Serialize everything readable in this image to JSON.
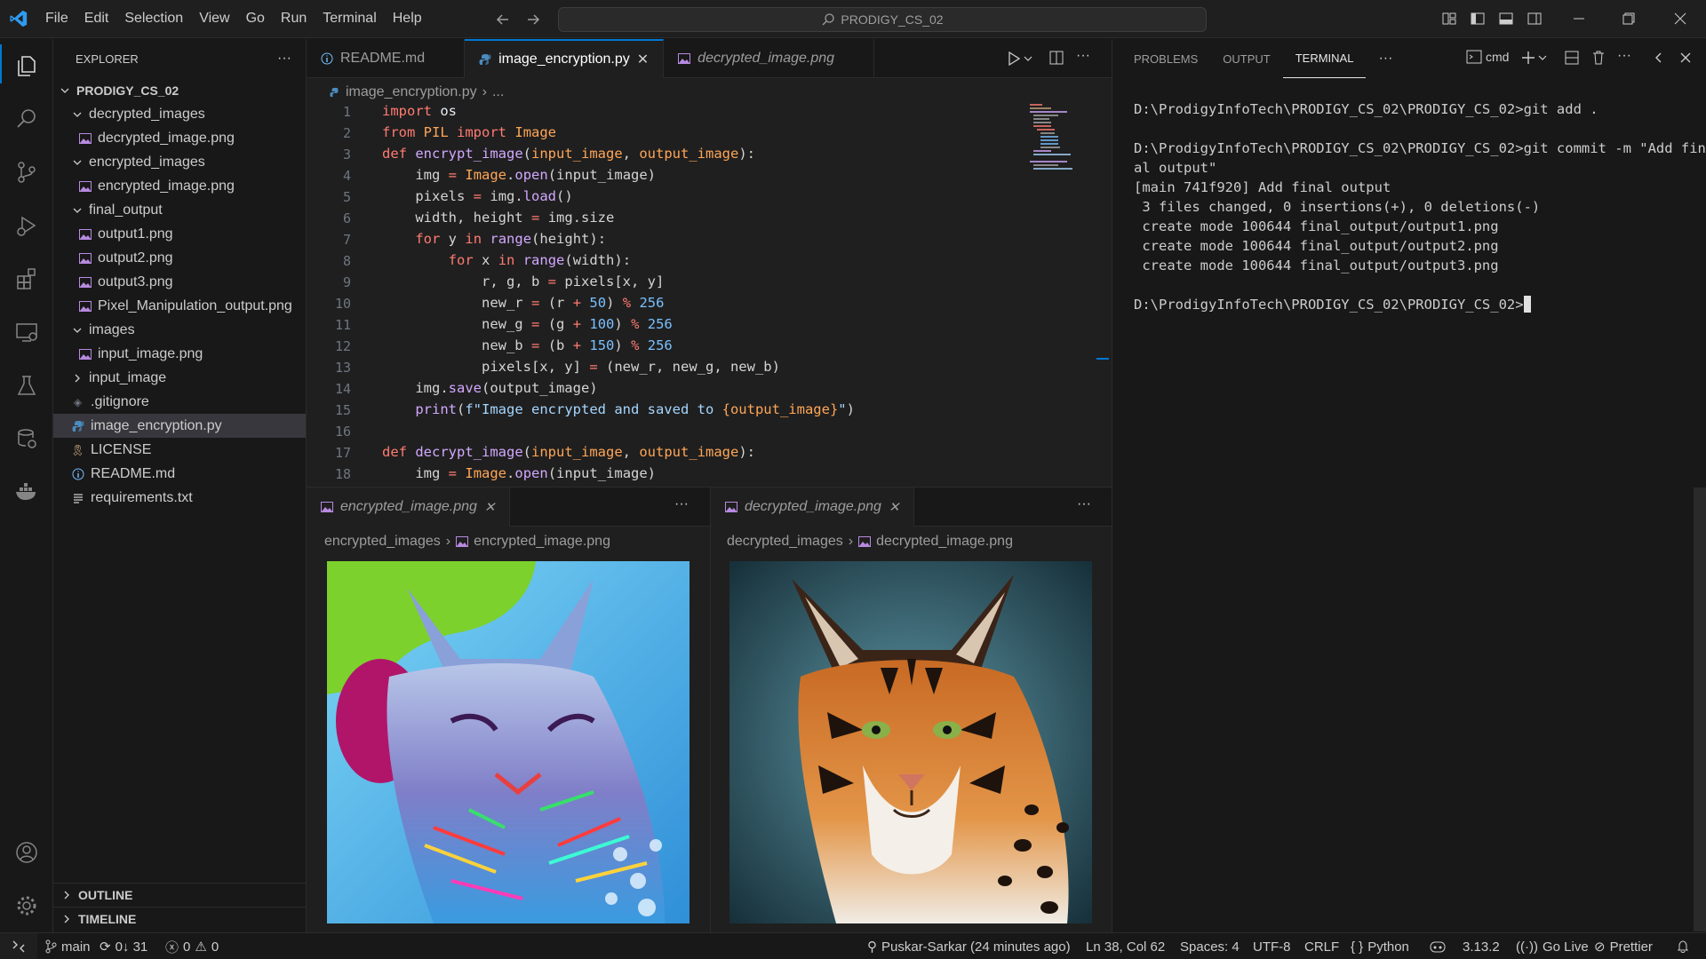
{
  "menu": [
    "File",
    "Edit",
    "Selection",
    "View",
    "Go",
    "Run",
    "Terminal",
    "Help"
  ],
  "command_center": "PRODIGY_CS_02",
  "explorer": {
    "title": "EXPLORER",
    "root": "PRODIGY_CS_02",
    "items": [
      {
        "label": "decrypted_images"
      },
      {
        "label": "decrypted_image.png"
      },
      {
        "label": "encrypted_images"
      },
      {
        "label": "encrypted_image.png"
      },
      {
        "label": "final_output"
      },
      {
        "label": "output1.png"
      },
      {
        "label": "output2.png"
      },
      {
        "label": "output3.png"
      },
      {
        "label": "Pixel_Manipulation_output.png"
      },
      {
        "label": "images"
      },
      {
        "label": "input_image.png"
      },
      {
        "label": "input_image"
      },
      {
        "label": ".gitignore"
      },
      {
        "label": "image_encryption.py"
      },
      {
        "label": "LICENSE"
      },
      {
        "label": "README.md"
      },
      {
        "label": "requirements.txt"
      }
    ],
    "outline": "OUTLINE",
    "timeline": "TIMELINE"
  },
  "editor": {
    "tabs": [
      "README.md",
      "image_encryption.py",
      "decrypted_image.png"
    ],
    "breadcrumb_file": "image_encryption.py",
    "breadcrumb_more": "...",
    "line_numbers": [
      "1",
      "2",
      "3",
      "4",
      "5",
      "6",
      "7",
      "8",
      "9",
      "10",
      "11",
      "12",
      "13",
      "14",
      "15",
      "16",
      "17",
      "18"
    ]
  },
  "preview_left": {
    "tab": "encrypted_image.png",
    "crumb_folder": "encrypted_images",
    "crumb_file": "encrypted_image.png"
  },
  "preview_right": {
    "tab": "decrypted_image.png",
    "crumb_folder": "decrypted_images",
    "crumb_file": "decrypted_image.png"
  },
  "panel": {
    "tabs": [
      "PROBLEMS",
      "OUTPUT",
      "TERMINAL"
    ],
    "shell": "cmd",
    "lines": [
      "D:\\ProdigyInfoTech\\PRODIGY_CS_02\\PRODIGY_CS_02>git add .",
      "",
      "D:\\ProdigyInfoTech\\PRODIGY_CS_02\\PRODIGY_CS_02>git commit -m \"Add fin",
      "al output\"",
      "[main 741f920] Add final output",
      " 3 files changed, 0 insertions(+), 0 deletions(-)",
      " create mode 100644 final_output/output1.png",
      " create mode 100644 final_output/output2.png",
      " create mode 100644 final_output/output3.png",
      "",
      "D:\\ProdigyInfoTech\\PRODIGY_CS_02\\PRODIGY_CS_02>"
    ]
  },
  "status": {
    "branch": "main",
    "sync": "0↓ 31",
    "errors": "0",
    "warnings": "0",
    "blame": "Puskar-Sarkar (24 minutes ago)",
    "position": "Ln 38, Col 62",
    "spaces": "Spaces: 4",
    "encoding": "UTF-8",
    "eol": "CRLF",
    "language": "Python",
    "version": "3.13.2",
    "golive": "Go Live",
    "prettier": "Prettier"
  },
  "colors": {
    "accent": "#0078d4",
    "background": "#1f1f1f",
    "sidebar": "#181818"
  }
}
